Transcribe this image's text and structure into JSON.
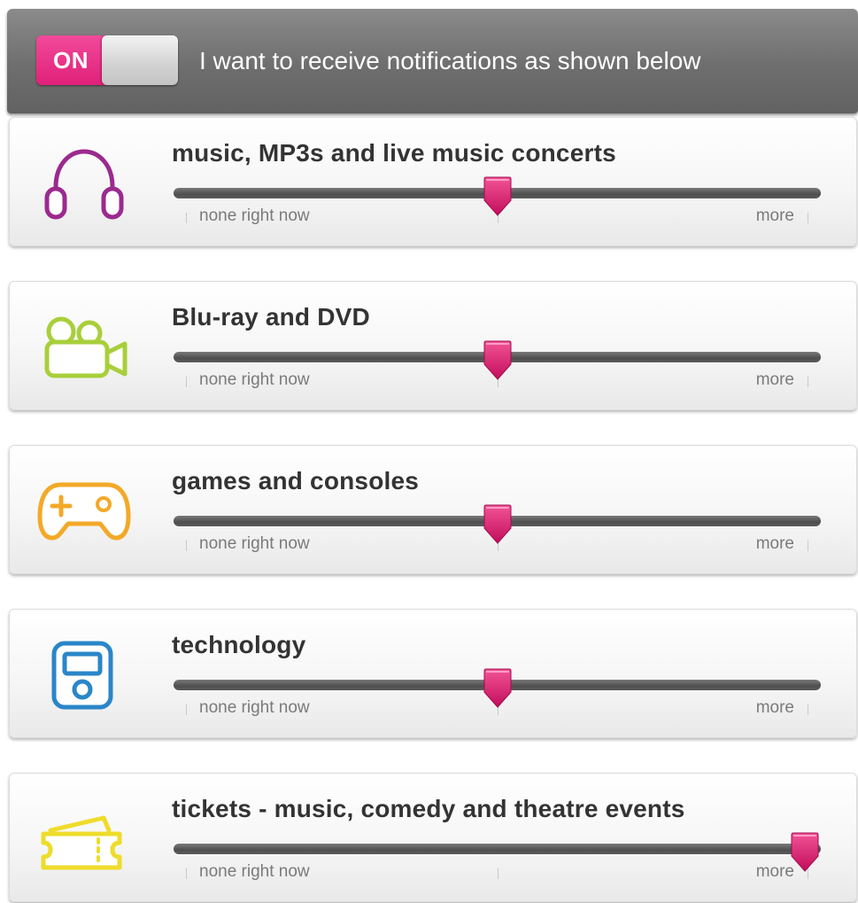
{
  "header": {
    "toggle_label": "ON",
    "toggle_state": "on",
    "text": "I want to receive notifications as shown below"
  },
  "slider_labels": {
    "min": "none right now",
    "max": "more"
  },
  "categories": [
    {
      "title": "music, MP3s and live music concerts",
      "icon": "headphones-icon",
      "icon_color": "#9b2a8e",
      "level": 0.5
    },
    {
      "title": "Blu-ray and DVD",
      "icon": "movie-camera-icon",
      "icon_color": "#a8cf3a",
      "level": 0.5
    },
    {
      "title": "games and consoles",
      "icon": "game-controller-icon",
      "icon_color": "#f3a928",
      "level": 0.5
    },
    {
      "title": "technology",
      "icon": "media-player-icon",
      "icon_color": "#2a86c8",
      "level": 0.5
    },
    {
      "title": "tickets - music, comedy and theatre events",
      "icon": "ticket-icon",
      "icon_color": "#eedc2a",
      "level": 1.0
    }
  ],
  "colors": {
    "accent": "#d8156a",
    "toggle_on": "#e8307e",
    "header_bg": "#757575"
  }
}
